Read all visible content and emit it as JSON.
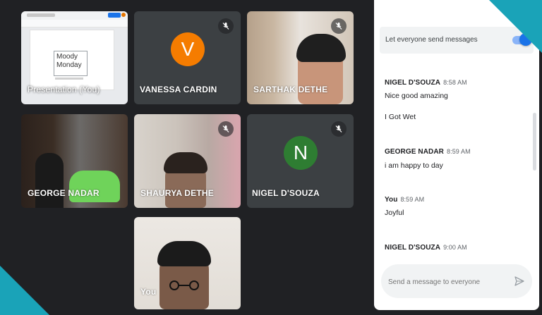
{
  "tiles": {
    "presentation": {
      "label": "Presentation (You)",
      "slide_line1": "Moody",
      "slide_line2": "Monday"
    },
    "vanessa": {
      "label": "VANESSA CARDIN",
      "initial": "V",
      "color": "#f57c00"
    },
    "sarthak": {
      "label": "SARTHAK DETHE"
    },
    "george": {
      "label": "GEORGE NADAR"
    },
    "shaurya": {
      "label": "SHAURYA DETHE"
    },
    "nigel": {
      "label": "NIGEL D'SOUZA",
      "initial": "N",
      "color": "#2e7d32"
    },
    "you": {
      "label": "You"
    }
  },
  "chat": {
    "toggle_label": "Let everyone send messages",
    "toggle_on": true,
    "messages": [
      {
        "sender": "NIGEL D'SOUZA",
        "time": "8:58 AM",
        "lines": [
          "Nice good amazing",
          "I Got Wet"
        ]
      },
      {
        "sender": "GEORGE NADAR",
        "time": "8:59 AM",
        "lines": [
          "i am happy to day"
        ]
      },
      {
        "sender": "You",
        "time": "8:59 AM",
        "lines": [
          "Joyful"
        ]
      },
      {
        "sender": "NIGEL D'SOUZA",
        "time": "9:00 AM",
        "lines": []
      }
    ],
    "input_placeholder": "Send a message to everyone",
    "accent": "#1a73e8"
  }
}
